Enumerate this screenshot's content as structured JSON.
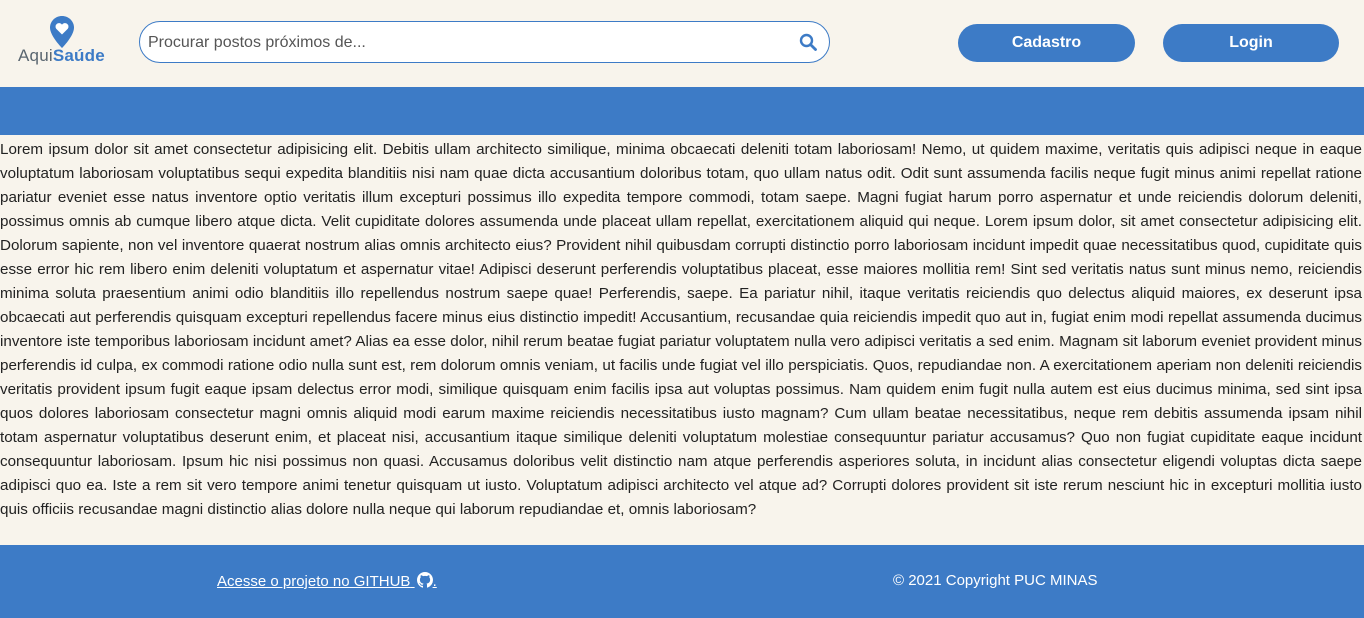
{
  "header": {
    "logo": {
      "text_light": "Aqui",
      "text_bold": "Saúde"
    },
    "search": {
      "placeholder": "Procurar postos próximos de...",
      "value": "",
      "icon": "search-icon"
    },
    "buttons": {
      "cadastro": "Cadastro",
      "login": "Login"
    }
  },
  "main": {
    "body_text": "Lorem ipsum dolor sit amet consectetur adipisicing elit. Debitis ullam architecto similique, minima obcaecati deleniti totam laboriosam! Nemo, ut quidem maxime, veritatis quis adipisci neque in eaque voluptatum laboriosam voluptatibus sequi expedita blanditiis nisi nam quae dicta accusantium doloribus totam, quo ullam natus odit. Odit sunt assumenda facilis neque fugit minus animi repellat ratione pariatur eveniet esse natus inventore optio veritatis illum excepturi possimus illo expedita tempore commodi, totam saepe. Magni fugiat harum porro aspernatur et unde reiciendis dolorum deleniti, possimus omnis ab cumque libero atque dicta. Velit cupiditate dolores assumenda unde placeat ullam repellat, exercitationem aliquid qui neque. Lorem ipsum dolor, sit amet consectetur adipisicing elit. Dolorum sapiente, non vel inventore quaerat nostrum alias omnis architecto eius? Provident nihil quibusdam corrupti distinctio porro laboriosam incidunt impedit quae necessitatibus quod, cupiditate quis esse error hic rem libero enim deleniti voluptatum et aspernatur vitae! Adipisci deserunt perferendis voluptatibus placeat, esse maiores mollitia rem! Sint sed veritatis natus sunt minus nemo, reiciendis minima soluta praesentium animi odio blanditiis illo repellendus nostrum saepe quae! Perferendis, saepe. Ea pariatur nihil, itaque veritatis reiciendis quo delectus aliquid maiores, ex deserunt ipsa obcaecati aut perferendis quisquam excepturi repellendus facere minus eius distinctio impedit! Accusantium, recusandae quia reiciendis impedit quo aut in, fugiat enim modi repellat assumenda ducimus inventore iste temporibus laboriosam incidunt amet? Alias ea esse dolor, nihil rerum beatae fugiat pariatur voluptatem nulla vero adipisci veritatis a sed enim. Magnam sit laborum eveniet provident minus perferendis id culpa, ex commodi ratione odio nulla sunt est, rem dolorum omnis veniam, ut facilis unde fugiat vel illo perspiciatis. Quos, repudiandae non. A exercitationem aperiam non deleniti reiciendis veritatis provident ipsum fugit eaque ipsam delectus error modi, similique quisquam enim facilis ipsa aut voluptas possimus. Nam quidem enim fugit nulla autem est eius ducimus minima, sed sint ipsa quos dolores laboriosam consectetur magni omnis aliquid modi earum maxime reiciendis necessitatibus iusto magnam? Cum ullam beatae necessitatibus, neque rem debitis assumenda ipsam nihil totam aspernatur voluptatibus deserunt enim, et placeat nisi, accusantium itaque similique deleniti voluptatum molestiae consequuntur pariatur accusamus? Quo non fugiat cupiditate eaque incidunt consequuntur laboriosam. Ipsum hic nisi possimus non quasi. Accusamus doloribus velit distinctio nam atque perferendis asperiores soluta, in incidunt alias consectetur eligendi voluptas dicta saepe adipisci quo ea. Iste a rem sit vero tempore animi tenetur quisquam ut iusto. Voluptatum adipisci architecto vel atque ad? Corrupti dolores provident sit iste rerum nesciunt hic in excepturi mollitia iusto quis officiis recusandae magni distinctio alias dolore nulla neque qui laborum repudiandae et, omnis laboriosam?"
  },
  "footer": {
    "github_link": "Acesse o projeto no GITHUB",
    "github_icon": "github-icon",
    "github_suffix": ".",
    "copyright": "© 2021 Copyright PUC MINAS"
  },
  "colors": {
    "accent": "#3d7bc6",
    "background": "#f8f4ec",
    "text": "#222222"
  }
}
